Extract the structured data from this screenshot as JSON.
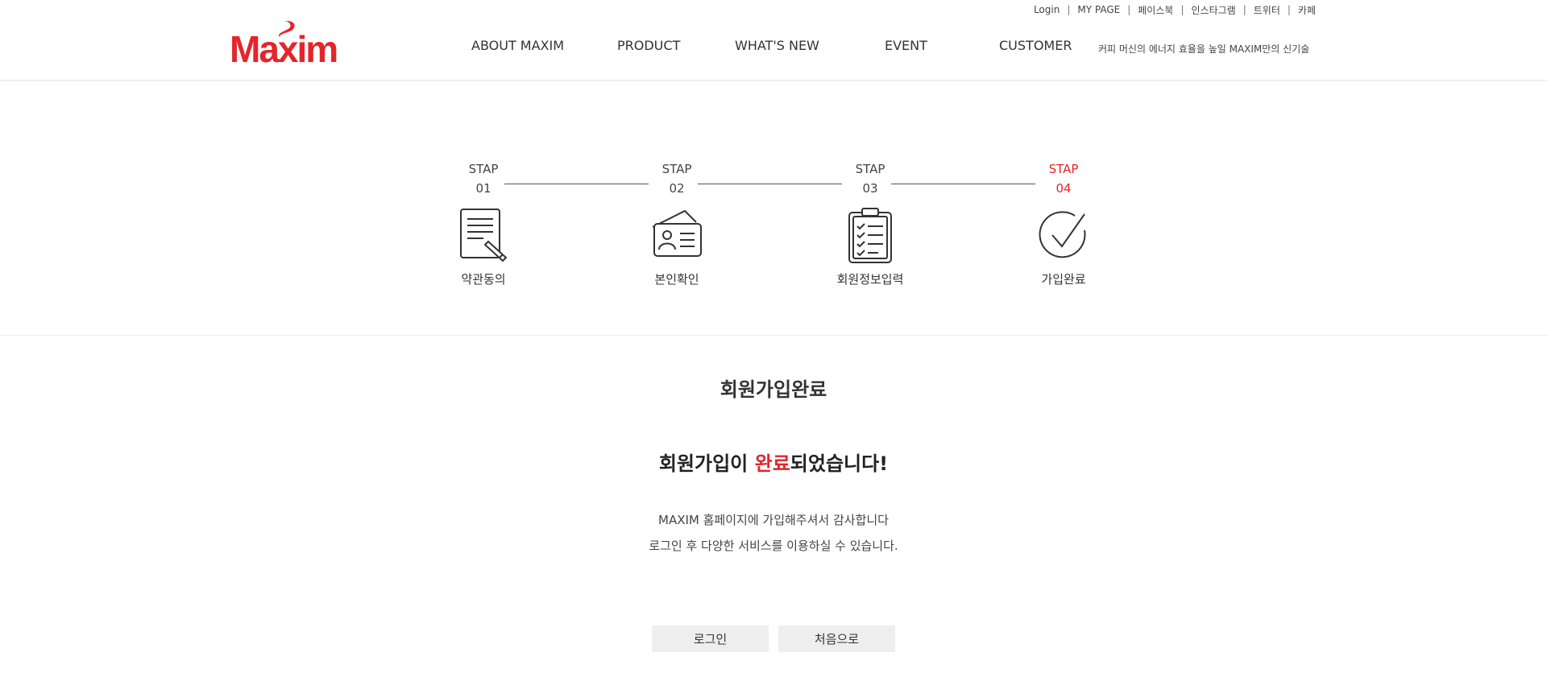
{
  "brand": {
    "logo_text": "Maxim",
    "color": "#e5242b"
  },
  "utility_links": [
    "Login",
    "MY PAGE",
    "페이스북",
    "인스타그램",
    "트위터",
    "카페"
  ],
  "nav": {
    "items": [
      "ABOUT MAXIM",
      "PRODUCT",
      "WHAT'S NEW",
      "EVENT",
      "CUSTOMER"
    ],
    "tagline": "커피 머신의 에너지 효율을 높일 MAXIM만의 신기술"
  },
  "steps": [
    {
      "label": "STAP",
      "num": "01",
      "name": "약관동의",
      "icon": "document-pen-icon"
    },
    {
      "label": "STAP",
      "num": "02",
      "name": "본인확인",
      "icon": "id-card-icon"
    },
    {
      "label": "STAP",
      "num": "03",
      "name": "회원정보입력",
      "icon": "clipboard-checklist-icon"
    },
    {
      "label": "STAP",
      "num": "04",
      "name": "가입완료",
      "icon": "check-circle-icon",
      "active": true
    }
  ],
  "content": {
    "title": "회원가입완료",
    "message_prefix": "회원가입이 ",
    "message_highlight": "완료",
    "message_suffix": "되었습니다!",
    "desc_line1": "MAXIM 홈페이지에 가입해주셔서 감사합니다",
    "desc_line2": "로그인 후 다양한 서비스를 이용하실 수 있습니다."
  },
  "buttons": {
    "login": "로그인",
    "home": "처음으로"
  }
}
